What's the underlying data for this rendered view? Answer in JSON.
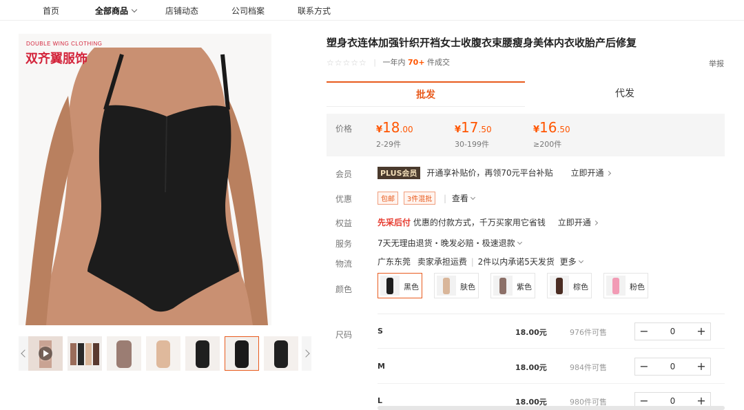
{
  "nav": {
    "items": [
      "首页",
      "全部商品",
      "店铺动态",
      "公司档案",
      "联系方式"
    ]
  },
  "brand": {
    "en": "DOUBLE WING CLOTHING",
    "cn": "双齐翼服饰"
  },
  "product": {
    "title": "塑身衣连体加强针织开裆女士收腹衣束腰瘦身美体内衣收胎产后修复",
    "stars": "☆☆☆☆☆",
    "sold_prefix": "一年内",
    "sold_count": "70+",
    "sold_suffix": "件成交",
    "report": "举报"
  },
  "tabs": {
    "wholesale": "批发",
    "dropship": "代发"
  },
  "price": {
    "label": "价格",
    "tiers": [
      {
        "yen": "¥",
        "int": "18",
        "dec": ".00",
        "range": "2-29件"
      },
      {
        "yen": "¥",
        "int": "17",
        "dec": ".50",
        "range": "30-199件"
      },
      {
        "yen": "¥",
        "int": "16",
        "dec": ".50",
        "range": "≥200件"
      }
    ]
  },
  "member": {
    "label": "会员",
    "badge": "PLUS会员",
    "text": "开通享补贴价，再领70元平台补贴",
    "link": "立即开通"
  },
  "promo": {
    "label": "优惠",
    "badge1": "包邮",
    "badge2": "3件混批",
    "view": "查看"
  },
  "rights": {
    "label": "权益",
    "highlight": "先采后付",
    "text": "优惠的付款方式，千万买家用它省钱",
    "link": "立即开通"
  },
  "service": {
    "label": "服务",
    "text": "7天无理由退货・晚发必赔・极速退款"
  },
  "logistics": {
    "label": "物流",
    "origin": "广东东莞",
    "fee": "卖家承担运费",
    "promise": "2件以内承诺5天发货",
    "more": "更多"
  },
  "colors": {
    "label": "颜色",
    "items": [
      {
        "name": "黑色",
        "swatch": "#1e1e1e"
      },
      {
        "name": "肤色",
        "swatch": "#d9b69a"
      },
      {
        "name": "紫色",
        "swatch": "#8c7068"
      },
      {
        "name": "棕色",
        "swatch": "#4a2c22"
      },
      {
        "name": "粉色",
        "swatch": "#f29bb5"
      }
    ]
  },
  "sizes": {
    "label": "尺码",
    "rows": [
      {
        "size": "S",
        "price": "18.00元",
        "stock": "976件可售",
        "qty": "0"
      },
      {
        "size": "M",
        "price": "18.00元",
        "stock": "984件可售",
        "qty": "0"
      },
      {
        "size": "L",
        "price": "18.00元",
        "stock": "980件可售",
        "qty": "0"
      }
    ]
  },
  "accent": "#e85a1c"
}
